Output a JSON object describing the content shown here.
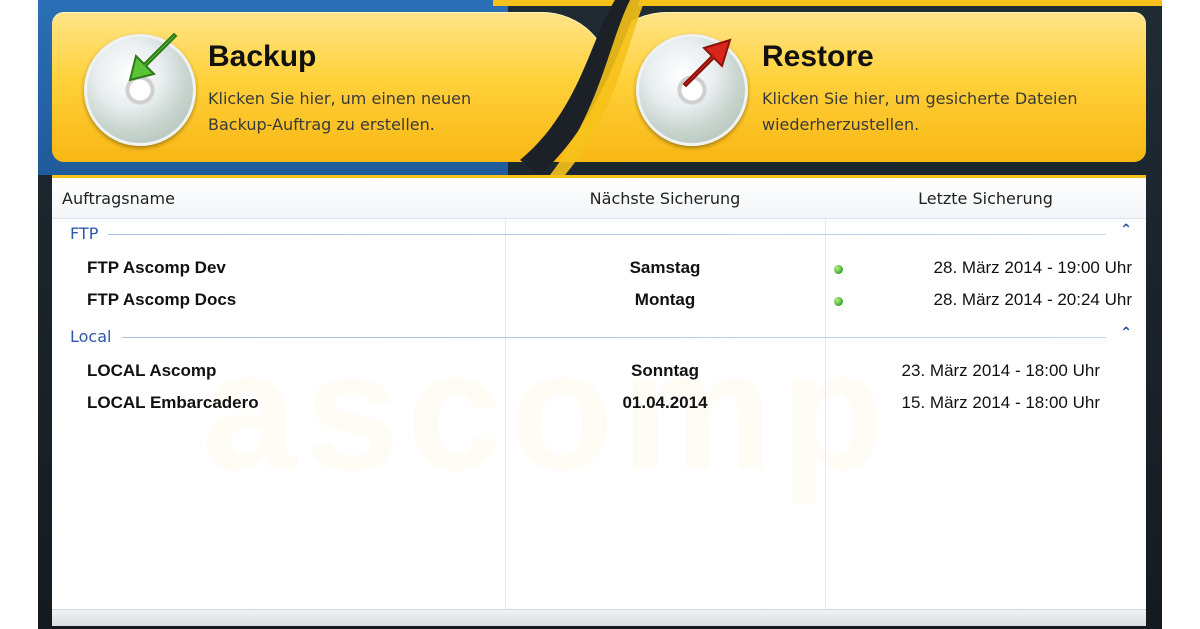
{
  "actions": {
    "backup": {
      "title": "Backup",
      "description_line1": "Klicken Sie hier, um einen neuen",
      "description_line2": "Backup-Auftrag zu erstellen.",
      "icon": "disc-green-arrow-in-icon"
    },
    "restore": {
      "title": "Restore",
      "description_line1": "Klicken Sie hier, um gesicherte Dateien",
      "description_line2": "wiederherzustellen.",
      "icon": "disc-red-arrow-out-icon"
    }
  },
  "table": {
    "columns": [
      "Auftragsname",
      "Nächste Sicherung",
      "Letzte Sicherung"
    ],
    "groups": [
      {
        "label": "FTP",
        "rows": [
          {
            "name": "FTP Ascomp Dev",
            "next": "Samstag",
            "last": "28. März 2014 - 19:00 Uhr",
            "status": "ok"
          },
          {
            "name": "FTP Ascomp Docs",
            "next": "Montag",
            "last": "28. März 2014 - 20:24 Uhr",
            "status": "ok"
          }
        ]
      },
      {
        "label": "Local",
        "rows": [
          {
            "name": "LOCAL Ascomp",
            "next": "Sonntag",
            "last": "23. März 2014 - 18:00 Uhr",
            "status": ""
          },
          {
            "name": "LOCAL Embarcadero",
            "next": "01.04.2014",
            "last": "15. März 2014 - 18:00 Uhr",
            "status": ""
          }
        ]
      }
    ]
  },
  "watermark": "ascomp",
  "colors": {
    "accent_yellow": "#f6c21a",
    "group_blue": "#2c58a8",
    "status_green": "#3aa82a"
  }
}
